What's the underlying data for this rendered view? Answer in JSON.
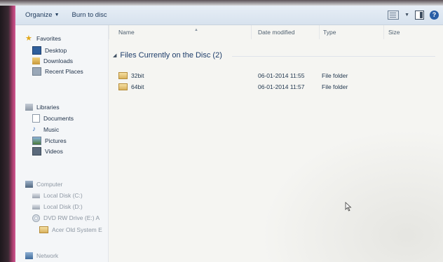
{
  "toolbar": {
    "organize_label": "Organize",
    "burn_label": "Burn to disc"
  },
  "nav": {
    "favorites": {
      "label": "Favorites",
      "items": [
        "Desktop",
        "Downloads",
        "Recent Places"
      ]
    },
    "libraries": {
      "label": "Libraries",
      "items": [
        "Documents",
        "Music",
        "Pictures",
        "Videos"
      ]
    },
    "computer": {
      "label": "Computer",
      "items": [
        "Local Disk (C:)",
        "Local Disk (D:)",
        "DVD RW Drive (E:) A",
        "Acer Old System E"
      ]
    },
    "network": {
      "label": "Network"
    }
  },
  "columns": {
    "name": "Name",
    "date": "Date modified",
    "type": "Type",
    "size": "Size"
  },
  "group": {
    "label": "Files Currently on the Disc (2)"
  },
  "files": [
    {
      "name": "32bit",
      "date": "06-01-2014 11:55",
      "type": "File folder",
      "icon": "folder-icon"
    },
    {
      "name": "64bit",
      "date": "06-01-2014 11:57",
      "type": "File folder",
      "icon": "folder-icon"
    }
  ],
  "colors": {
    "toolbar_bg": "#dde6f0",
    "text": "#1e3048",
    "accent": "#2a5ea6"
  }
}
